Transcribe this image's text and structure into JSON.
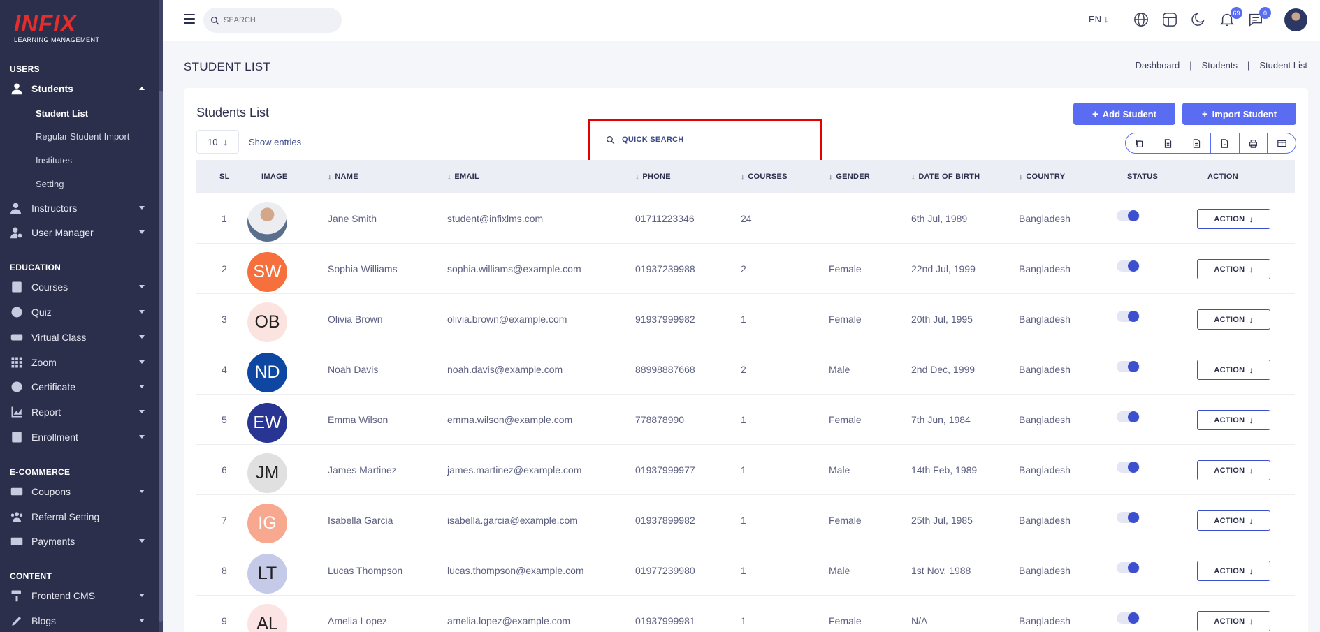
{
  "brand": {
    "name": "INFIX",
    "tagline": "LEARNING MANAGEMENT"
  },
  "sidebar": {
    "sections": [
      {
        "title": "USERS"
      },
      {
        "title": "EDUCATION"
      },
      {
        "title": "E-COMMERCE"
      },
      {
        "title": "CONTENT"
      }
    ],
    "items": [
      {
        "label": "Students",
        "icon": "user-icon"
      },
      {
        "label": "Instructors",
        "icon": "instructor-icon"
      },
      {
        "label": "User Manager",
        "icon": "user-gear-icon"
      },
      {
        "label": "Courses",
        "icon": "book-icon"
      },
      {
        "label": "Quiz",
        "icon": "question-icon"
      },
      {
        "label": "Virtual Class",
        "icon": "vr-icon"
      },
      {
        "label": "Zoom",
        "icon": "grid-icon"
      },
      {
        "label": "Certificate",
        "icon": "certificate-icon"
      },
      {
        "label": "Report",
        "icon": "chart-icon"
      },
      {
        "label": "Enrollment",
        "icon": "enrollment-icon"
      },
      {
        "label": "Coupons",
        "icon": "ticket-icon"
      },
      {
        "label": "Referral Setting",
        "icon": "users-icon"
      },
      {
        "label": "Payments",
        "icon": "money-icon"
      },
      {
        "label": "Frontend CMS",
        "icon": "paint-roller-icon"
      },
      {
        "label": "Blogs",
        "icon": "blog-icon"
      }
    ],
    "student_sub": [
      "Student List",
      "Regular Student Import",
      "Institutes",
      "Setting"
    ]
  },
  "topbar": {
    "search_placeholder": "SEARCH",
    "language": "EN ↓",
    "notifications_count": "69",
    "messages_count": "0"
  },
  "page": {
    "title": "STUDENT LIST",
    "breadcrumb": [
      "Dashboard",
      "Students",
      "Student List"
    ],
    "card_title": "Students List",
    "add_student": "Add Student",
    "import_student": "Import Student",
    "entries_value": "10",
    "show_entries": "Show entries",
    "quick_search_placeholder": "QUICK SEARCH"
  },
  "table": {
    "headers": {
      "sl": "SL",
      "image": "IMAGE",
      "name": "NAME",
      "email": "EMAIL",
      "phone": "PHONE",
      "courses": "COURSES",
      "gender": "GENDER",
      "dob": "DATE OF BIRTH",
      "country": "COUNTRY",
      "status": "STATUS",
      "action": "ACTION"
    },
    "action_label": "ACTION",
    "rows": [
      {
        "sl": "1",
        "initials": "",
        "avatar_color": "#dfe3e8",
        "name": "Jane Smith",
        "email": "student@infixlms.com",
        "phone": "01711223346",
        "courses": "24",
        "gender": "",
        "dob": "6th Jul, 1989",
        "country": "Bangladesh"
      },
      {
        "sl": "2",
        "initials": "SW",
        "avatar_color": "#f5703d",
        "name": "Sophia Williams",
        "email": "sophia.williams@example.com",
        "phone": "01937239988",
        "courses": "2",
        "gender": "Female",
        "dob": "22nd Jul, 1999",
        "country": "Bangladesh"
      },
      {
        "sl": "3",
        "initials": "OB",
        "avatar_color": "#fbe3e0",
        "name": "Olivia Brown",
        "email": "olivia.brown@example.com",
        "phone": "91937999982",
        "courses": "1",
        "gender": "Female",
        "dob": "20th Jul, 1995",
        "country": "Bangladesh"
      },
      {
        "sl": "4",
        "initials": "ND",
        "avatar_color": "#0e47a1",
        "name": "Noah Davis",
        "email": "noah.davis@example.com",
        "phone": "88998887668",
        "courses": "2",
        "gender": "Male",
        "dob": "2nd Dec, 1999",
        "country": "Bangladesh"
      },
      {
        "sl": "5",
        "initials": "EW",
        "avatar_color": "#283593",
        "name": "Emma Wilson",
        "email": "emma.wilson@example.com",
        "phone": "778878990",
        "courses": "1",
        "gender": "Female",
        "dob": "7th Jun, 1984",
        "country": "Bangladesh"
      },
      {
        "sl": "6",
        "initials": "JM",
        "avatar_color": "#e0e0e0",
        "name": "James Martinez",
        "email": "james.martinez@example.com",
        "phone": "01937999977",
        "courses": "1",
        "gender": "Male",
        "dob": "14th Feb, 1989",
        "country": "Bangladesh"
      },
      {
        "sl": "7",
        "initials": "IG",
        "avatar_color": "#f8a88f",
        "name": "Isabella Garcia",
        "email": "isabella.garcia@example.com",
        "phone": "01937899982",
        "courses": "1",
        "gender": "Female",
        "dob": "25th Jul, 1985",
        "country": "Bangladesh"
      },
      {
        "sl": "8",
        "initials": "LT",
        "avatar_color": "#c5cae9",
        "name": "Lucas Thompson",
        "email": "lucas.thompson@example.com",
        "phone": "01977239980",
        "courses": "1",
        "gender": "Male",
        "dob": "1st Nov, 1988",
        "country": "Bangladesh"
      },
      {
        "sl": "9",
        "initials": "AL",
        "avatar_color": "#fce4e4",
        "name": "Amelia Lopez",
        "email": "amelia.lopez@example.com",
        "phone": "01937999981",
        "courses": "1",
        "gender": "Female",
        "dob": "N/A",
        "country": "Bangladesh"
      }
    ]
  },
  "colors": {
    "sidebar_bg": "#2b2f4b",
    "accent": "#5a6cf2",
    "highlight": "#e30000"
  }
}
